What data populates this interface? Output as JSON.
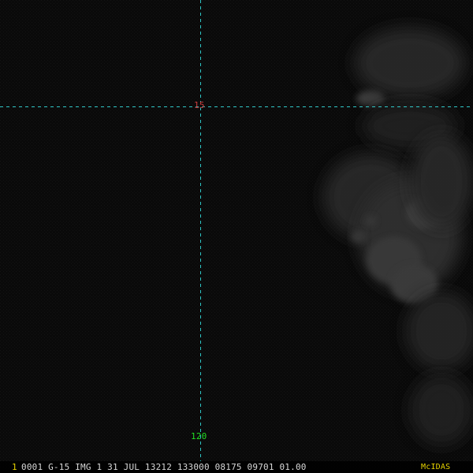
{
  "image": {
    "kind": "satellite visible imagery",
    "background_color": "#0b0b0b",
    "grid_color": "#2fc7c7",
    "cloud_color": "#5a5a5a"
  },
  "grid": {
    "latitude_label": "15",
    "longitude_label": "120",
    "latitude_label_color": "#cc3b3b",
    "longitude_label_color": "#22dd22"
  },
  "status_bar": {
    "frame_number": "1",
    "text": "0001 G-15 IMG   1 31 JUL 13212 133000 08175 09701 01.00",
    "brand": "McIDAS",
    "text_color": "#d8d8d8",
    "accent_color": "#e6d200"
  }
}
